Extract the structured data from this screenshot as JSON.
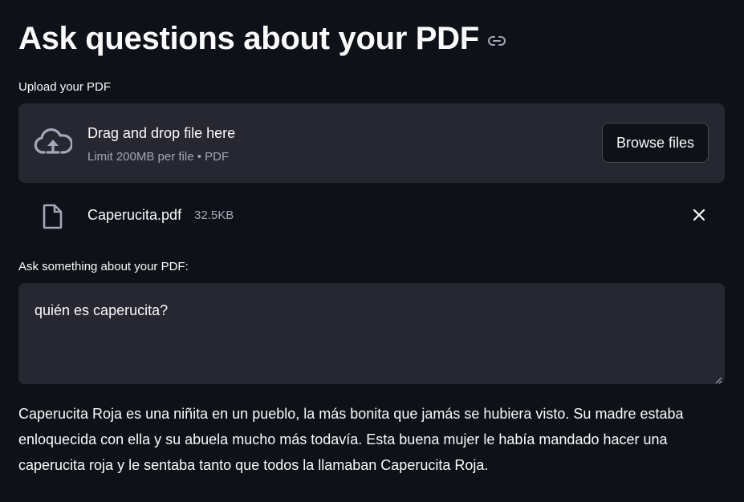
{
  "header": {
    "title": "Ask questions about your PDF",
    "anchor_icon": "link-icon"
  },
  "uploader": {
    "label": "Upload your PDF",
    "dropzone_title": "Drag and drop file here",
    "dropzone_subtitle": "Limit 200MB per file • PDF",
    "browse_label": "Browse files",
    "upload_icon": "cloud-upload-icon"
  },
  "uploaded_file": {
    "name": "Caperucita.pdf",
    "size": "32.5KB",
    "file_icon": "document-icon",
    "remove_icon": "close-icon"
  },
  "question": {
    "label": "Ask something about your PDF:",
    "value": "quién es caperucita?"
  },
  "answer": {
    "text": "Caperucita Roja es una niñita en un pueblo, la más bonita que jamás se hubiera visto. Su madre estaba enloquecida con ella y su abuela mucho más todavía. Esta buena mujer le había mandado hacer una caperucita roja y le sentaba tanto que todos la llamaban Caperucita Roja."
  },
  "colors": {
    "background": "#0e1117",
    "surface": "#262730",
    "text": "#fafafa",
    "muted_text": "#a3a8b8"
  }
}
